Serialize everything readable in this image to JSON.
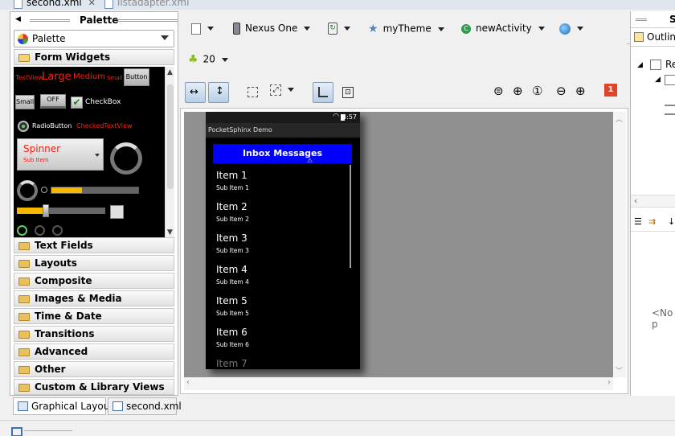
{
  "editor_tabs": [
    {
      "label": "second.xml",
      "active": true
    },
    {
      "label": "listadapter.xml",
      "active": false
    }
  ],
  "palette": {
    "header": "Palette",
    "combo": "Palette",
    "open_category": "Form Widgets",
    "widgets": {
      "textview": "TextView",
      "large": "Large",
      "medium": "Medium",
      "small": "Small",
      "button": "Button",
      "small_button": "Small",
      "toggle_off": "OFF",
      "checkbox": "CheckBox",
      "radio": "RadioButton",
      "checked_text": "CheckedTextView",
      "spinner": "Spinner",
      "sub_item": "Sub Item",
      "progress_fill_fraction": 0.35,
      "seek_fraction": 0.33
    },
    "categories": [
      "Text Fields",
      "Layouts",
      "Composite",
      "Images & Media",
      "Time & Date",
      "Transitions",
      "Advanced",
      "Other",
      "Custom & Library Views"
    ]
  },
  "toolbar": {
    "device": "Nexus One",
    "theme": "myTheme",
    "activity": "newActivity",
    "api": "20",
    "error_count": "1"
  },
  "device": {
    "time": "4:57",
    "app_title": "PocketSphinx Demo",
    "header": "Inbox Messages",
    "items": [
      {
        "title": "Item 1",
        "sub": "Sub Item 1"
      },
      {
        "title": "Item 2",
        "sub": "Sub Item 2"
      },
      {
        "title": "Item 3",
        "sub": "Sub Item 3"
      },
      {
        "title": "Item 4",
        "sub": "Sub Item 4"
      },
      {
        "title": "Item 5",
        "sub": "Sub Item 5"
      },
      {
        "title": "Item 6",
        "sub": "Sub Item 6"
      },
      {
        "title": "Item 7",
        "sub": ""
      }
    ]
  },
  "bottom_tabs": {
    "graphical": "Graphical Layout",
    "xml": "second.xml"
  },
  "right": {
    "title": "S",
    "outline": "Outlin",
    "re": "Re",
    "no_text": "<No p"
  }
}
